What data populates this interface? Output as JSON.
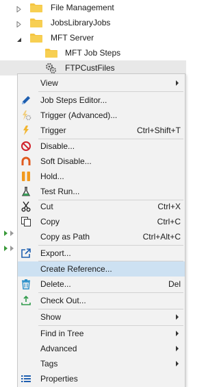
{
  "tree": {
    "items": [
      {
        "label": "File Management"
      },
      {
        "label": "JobsLibraryJobs"
      },
      {
        "label": "MFT Server"
      },
      {
        "label": "MFT Job Steps"
      },
      {
        "label": "FTPCustFiles"
      }
    ]
  },
  "context_menu": {
    "items": [
      {
        "label": "View",
        "shortcut": "",
        "icon": "none"
      },
      {
        "label": "Job Steps Editor...",
        "shortcut": "",
        "icon": "pencil-icon"
      },
      {
        "label": "Trigger (Advanced)...",
        "shortcut": "",
        "icon": "lightning-gear-icon"
      },
      {
        "label": "Trigger",
        "shortcut": "Ctrl+Shift+T",
        "icon": "lightning-icon"
      },
      {
        "label": "Disable...",
        "shortcut": "",
        "icon": "no-entry-icon"
      },
      {
        "label": "Soft Disable...",
        "shortcut": "",
        "icon": "horseshoe-icon"
      },
      {
        "label": "Hold...",
        "shortcut": "",
        "icon": "pause-icon"
      },
      {
        "label": "Test Run...",
        "shortcut": "",
        "icon": "flask-icon"
      },
      {
        "label": "Cut",
        "shortcut": "Ctrl+X",
        "icon": "scissors-icon"
      },
      {
        "label": "Copy",
        "shortcut": "Ctrl+C",
        "icon": "copy-icon"
      },
      {
        "label": "Copy as Path",
        "shortcut": "Ctrl+Alt+C",
        "icon": "none"
      },
      {
        "label": "Export...",
        "shortcut": "",
        "icon": "export-icon"
      },
      {
        "label": "Create Reference...",
        "shortcut": "",
        "icon": "none"
      },
      {
        "label": "Delete...",
        "shortcut": "Del",
        "icon": "trash-icon"
      },
      {
        "label": "Check Out...",
        "shortcut": "",
        "icon": "checkout-icon"
      },
      {
        "label": "Show",
        "shortcut": "",
        "icon": "none"
      },
      {
        "label": "Find in Tree",
        "shortcut": "",
        "icon": "none"
      },
      {
        "label": "Advanced",
        "shortcut": "",
        "icon": "none"
      },
      {
        "label": "Tags",
        "shortcut": "",
        "icon": "none"
      },
      {
        "label": "Properties",
        "shortcut": "",
        "icon": "properties-icon"
      }
    ]
  },
  "colors": {
    "highlight": "#cde1f2",
    "folder": "#f5c542",
    "menu_bg": "#f2f2f2"
  }
}
